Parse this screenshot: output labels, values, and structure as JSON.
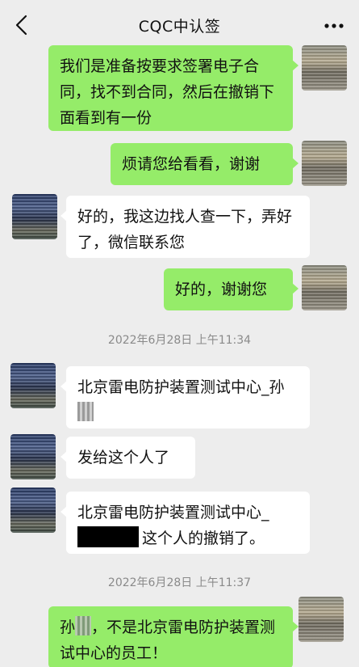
{
  "header": {
    "title": "CQC中认签"
  },
  "messages": [
    {
      "text": "我们是准备按要求签署电子合同，找不到合同，然后在撤销下面看到有一份"
    },
    {
      "text": "烦请您给看看，谢谢"
    },
    {
      "text": "好的，我这边找人查一下，弄好了，微信联系您"
    },
    {
      "text": "好的，谢谢您"
    },
    {
      "text": "北京雷电防护装置测试中心_孙"
    },
    {
      "text": "发给这个人了"
    },
    {
      "text_before": "北京雷电防护装置测试中心_",
      "text_after": "这个人的撤销了。"
    },
    {
      "text_start": "孙",
      "text_rest": "，不是北京雷电防护装置测试中心的员工！"
    }
  ],
  "timestamps": [
    "2022年6月28日 上午11:34",
    "2022年6月28日 上午11:37"
  ],
  "icons": {
    "back": "chevron-left-icon",
    "more": "more-dots-icon"
  },
  "colors": {
    "sent_bubble": "#95ec69",
    "received_bubble": "#ffffff",
    "background": "#ededed"
  }
}
